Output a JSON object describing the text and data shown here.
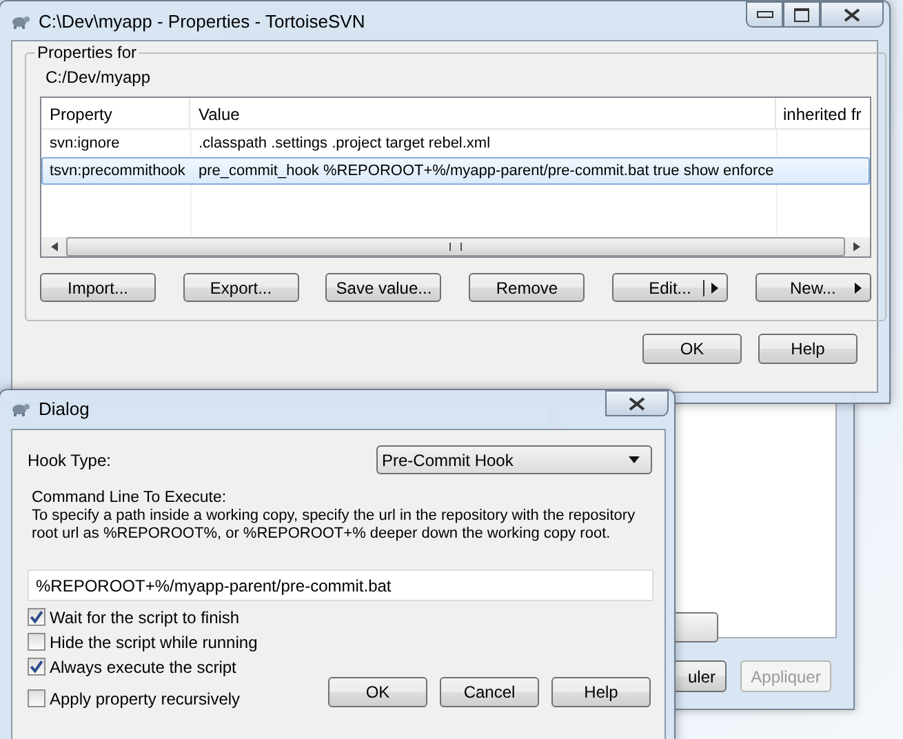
{
  "main_window": {
    "title": "C:\\Dev\\myapp - Properties - TortoiseSVN",
    "group_label": "Properties for",
    "path": "C:/Dev/myapp",
    "table": {
      "columns": [
        "Property",
        "Value",
        "inherited fr"
      ],
      "rows": [
        {
          "property": "svn:ignore",
          "value": ".classpath .settings .project target rebel.xml",
          "selected": false
        },
        {
          "property": "tsvn:precommithook",
          "value": "pre_commit_hook %REPOROOT+%/myapp-parent/pre-commit.bat true show enforce",
          "selected": true
        }
      ]
    },
    "buttons": [
      {
        "label": "Import...",
        "kind": "plain"
      },
      {
        "label": "Export...",
        "kind": "plain"
      },
      {
        "label": "Save value...",
        "kind": "plain"
      },
      {
        "label": "Remove",
        "kind": "plain"
      },
      {
        "label": "Edit...",
        "kind": "split"
      },
      {
        "label": "New...",
        "kind": "menu"
      }
    ],
    "footer_buttons": [
      "OK",
      "Help"
    ]
  },
  "background_window": {
    "buttons": [
      {
        "label": "uler",
        "disabled": false
      },
      {
        "label": "Appliquer",
        "disabled": true
      }
    ]
  },
  "dialog": {
    "title": "Dialog",
    "hook_type_label": "Hook Type:",
    "hook_type": "Pre-Commit Hook",
    "command_label": "Command Line To Execute:",
    "help_text": "To specify a path inside a working copy, specify the url in the repository with the repository root url as %REPOROOT%, or %REPOROOT+% deeper down the working copy root.",
    "command": "%REPOROOT+%/myapp-parent/pre-commit.bat",
    "options": [
      {
        "label": "Wait for the script to finish",
        "checked": true
      },
      {
        "label": "Hide the script while running",
        "checked": false
      },
      {
        "label": "Always execute the script",
        "checked": true
      }
    ],
    "recursive": {
      "label": "Apply property recursively",
      "checked": false
    },
    "buttons": [
      "OK",
      "Cancel",
      "Help"
    ]
  }
}
